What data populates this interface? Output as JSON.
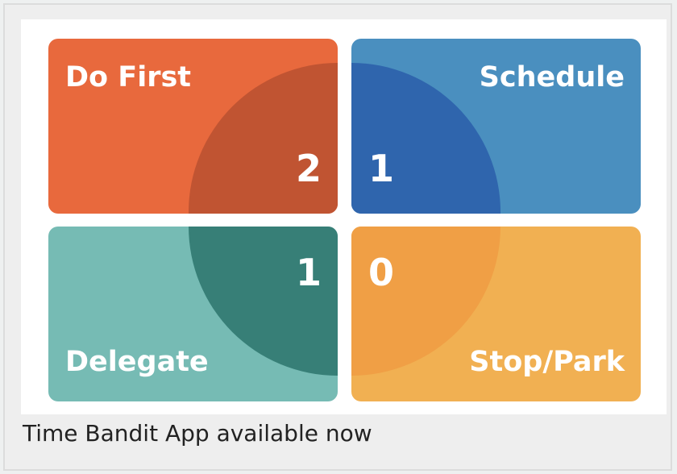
{
  "matrix": {
    "do_first": {
      "label": "Do First",
      "count": "2",
      "color": "#e8693d"
    },
    "schedule": {
      "label": "Schedule",
      "count": "1",
      "color": "#4a8fbf"
    },
    "delegate": {
      "label": "Delegate",
      "count": "1",
      "color": "#76bbb4"
    },
    "stop_park": {
      "label": "Stop/Park",
      "count": "0",
      "color": "#f1b052"
    }
  },
  "caption": "Time Bandit App available now"
}
